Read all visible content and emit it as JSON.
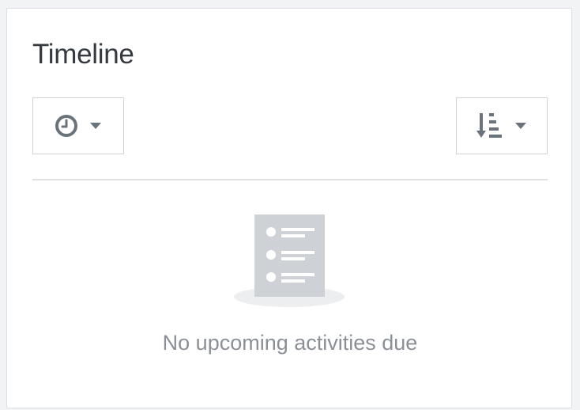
{
  "timeline": {
    "title": "Timeline",
    "filter_dropdown": {
      "icon": "clock-icon",
      "caret": "caret-down-icon"
    },
    "sort_dropdown": {
      "icon": "sort-amount-down-icon",
      "caret": "caret-down-icon"
    },
    "empty_state": {
      "illustration": "document-list-icon",
      "message": "No upcoming activities due"
    }
  },
  "colors": {
    "icon": "#6a737b",
    "illustration": "#ced1d5",
    "text_muted": "#8b9097",
    "border": "#ced4da"
  }
}
